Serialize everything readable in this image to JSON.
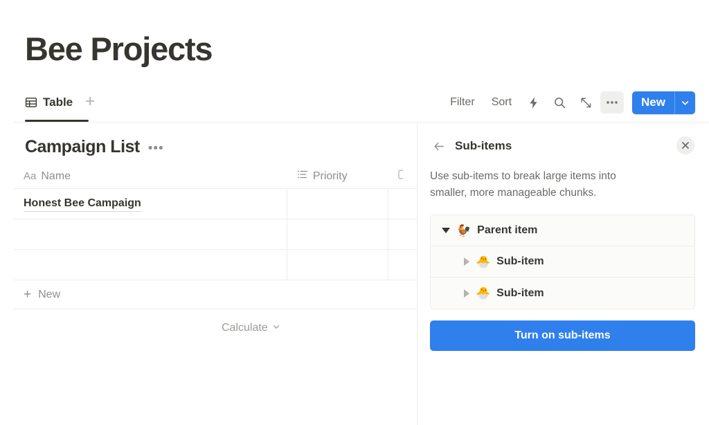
{
  "page": {
    "title": "Bee Projects"
  },
  "tabs": [
    {
      "label": "Table",
      "icon": "table-icon",
      "active": true
    }
  ],
  "tab_add_label": "+",
  "toolbar": {
    "filter_label": "Filter",
    "sort_label": "Sort",
    "automation_icon": "lightning-icon",
    "search_icon": "search-icon",
    "expand_icon": "expand-icon",
    "more_icon": "ellipsis-icon",
    "new_label": "New",
    "new_caret_icon": "chevron-down-icon"
  },
  "database": {
    "title": "Campaign List",
    "more_icon": "ellipsis-icon",
    "columns": [
      {
        "label": "Name",
        "type_icon": "Aa"
      },
      {
        "label": "Priority",
        "type_icon": "list-icon"
      },
      {
        "label": "",
        "type_icon": "property-icon"
      }
    ],
    "rows": [
      {
        "name": "Honest Bee Campaign",
        "priority": ""
      },
      {
        "name": "",
        "priority": ""
      },
      {
        "name": "",
        "priority": ""
      }
    ],
    "new_row_label": "New",
    "calculate_label": "Calculate"
  },
  "side_panel": {
    "back_icon": "arrow-left-icon",
    "title": "Sub-items",
    "close_icon": "close-icon",
    "description": "Use sub-items to break large items into smaller, more manageable chunks.",
    "preview": [
      {
        "label": "Parent item",
        "emoji": "🐓",
        "toggle": "down",
        "level": 0
      },
      {
        "label": "Sub-item",
        "emoji": "🐣",
        "toggle": "right",
        "level": 1
      },
      {
        "label": "Sub-item",
        "emoji": "🐣",
        "toggle": "right",
        "level": 1
      }
    ],
    "cta_label": "Turn on sub-items"
  },
  "colors": {
    "accent_blue": "#2f80ed",
    "text_primary": "#37352f",
    "text_muted": "#8f8e8a",
    "border": "#ececeb",
    "card_bg": "#fbfbfa"
  }
}
